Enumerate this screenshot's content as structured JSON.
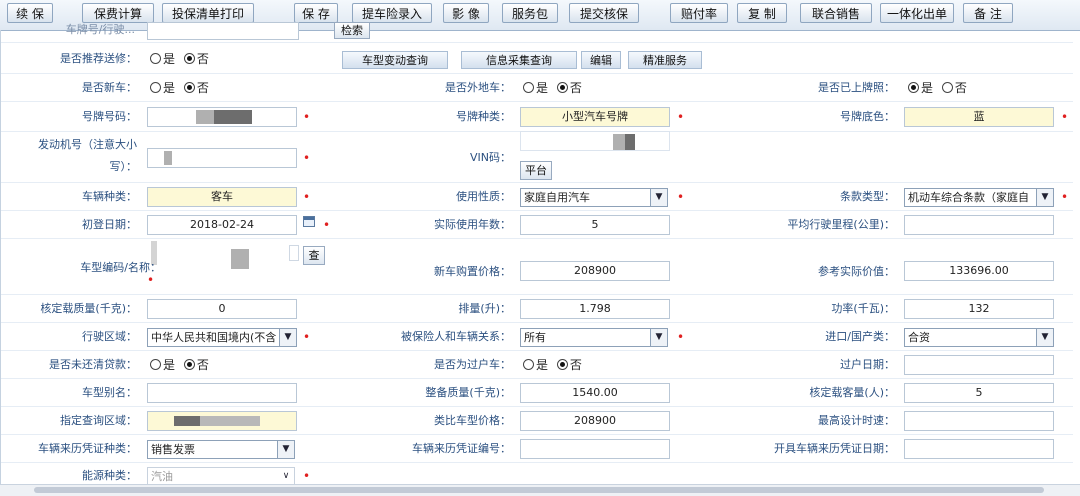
{
  "toolbar": {
    "buttons": [
      "续 保",
      "保费计算",
      "投保清单打印",
      "保 存",
      "提车险录入",
      "影 像",
      "服务包",
      "提交核保",
      "赔付率",
      "复 制",
      "联合销售",
      "一体化出单",
      "备 注"
    ]
  },
  "top_row": {
    "label": "车牌号/行驶...",
    "partial_button": "检索"
  },
  "recommend_row": {
    "label": "是否推荐送修：",
    "yes": "是",
    "no": "否",
    "selected": "否",
    "buttons": [
      "车型变动查询",
      "信息采集查询",
      "编辑",
      "精准服务"
    ]
  },
  "new_car": {
    "label": "是否新车：",
    "yes": "是",
    "no": "否",
    "selected": "否"
  },
  "other_place": {
    "label": "是否外地车：",
    "yes": "是",
    "no": "否",
    "selected": "否"
  },
  "plated": {
    "label": "是否已上牌照：",
    "yes": "是",
    "no": "否",
    "selected": "是"
  },
  "plate_no": {
    "label": "号牌号码："
  },
  "plate_type": {
    "label": "号牌种类：",
    "value": "小型汽车号牌"
  },
  "plate_color": {
    "label": "号牌底色：",
    "value": "蓝"
  },
  "engine_no": {
    "label_line1": "发动机号（注意大小",
    "label_line2": "写）："
  },
  "vin": {
    "label": "VIN码：",
    "button": "平台"
  },
  "vehicle_kind": {
    "label": "车辆种类：",
    "value": "客车"
  },
  "use_nature": {
    "label": "使用性质：",
    "value": "家庭自用汽车"
  },
  "clause_type": {
    "label": "条款类型：",
    "value": "机动车综合条款（家庭自"
  },
  "first_reg": {
    "label": "初登日期：",
    "value": "2018-02-24"
  },
  "actual_years": {
    "label": "实际使用年数：",
    "value": "5"
  },
  "avg_mileage": {
    "label": "平均行驶里程(公里)：",
    "value": ""
  },
  "model_code": {
    "label": "车型编码/名称：",
    "button": "查"
  },
  "new_price": {
    "label": "新车购置价格：",
    "value": "208900"
  },
  "ref_value": {
    "label": "参考实际价值：",
    "value": "133696.00"
  },
  "load_mass": {
    "label": "核定载质量(千克)：",
    "value": "0"
  },
  "displacement": {
    "label": "排量(升)：",
    "value": "1.798"
  },
  "power": {
    "label": "功率(千瓦)：",
    "value": "132"
  },
  "drive_area": {
    "label": "行驶区域：",
    "value": "中华人民共和国境内(不含"
  },
  "relation": {
    "label": "被保险人和车辆关系：",
    "value": "所有"
  },
  "import_type": {
    "label": "进口/国产类：",
    "value": "合资"
  },
  "loan": {
    "label": "是否未还清贷款：",
    "yes": "是",
    "no": "否",
    "selected": "否"
  },
  "transfer": {
    "label": "是否为过户车：",
    "yes": "是",
    "no": "否",
    "selected": "否"
  },
  "transfer_date": {
    "label": "过户日期：",
    "value": ""
  },
  "alias": {
    "label": "车型别名：",
    "value": ""
  },
  "curb_weight": {
    "label": "整备质量(千克)：",
    "value": "1540.00"
  },
  "seats": {
    "label": "核定载客量(人)：",
    "value": "5"
  },
  "check_area": {
    "label": "指定查询区域："
  },
  "similar_price": {
    "label": "类比车型价格：",
    "value": "208900"
  },
  "max_speed": {
    "label": "最高设计时速：",
    "value": ""
  },
  "cert_type": {
    "label": "车辆来历凭证种类：",
    "value": "销售发票"
  },
  "cert_no": {
    "label": "车辆来历凭证编号：",
    "value": ""
  },
  "cert_date": {
    "label": "开具车辆来历凭证日期：",
    "value": ""
  },
  "energy": {
    "label": "能源种类：",
    "value": "汽油"
  },
  "colors": {
    "label": "#2b5080",
    "required": "#e02020",
    "highlight_field": "#fdf9d6",
    "toolbar_bg": "#dfe8f2"
  }
}
